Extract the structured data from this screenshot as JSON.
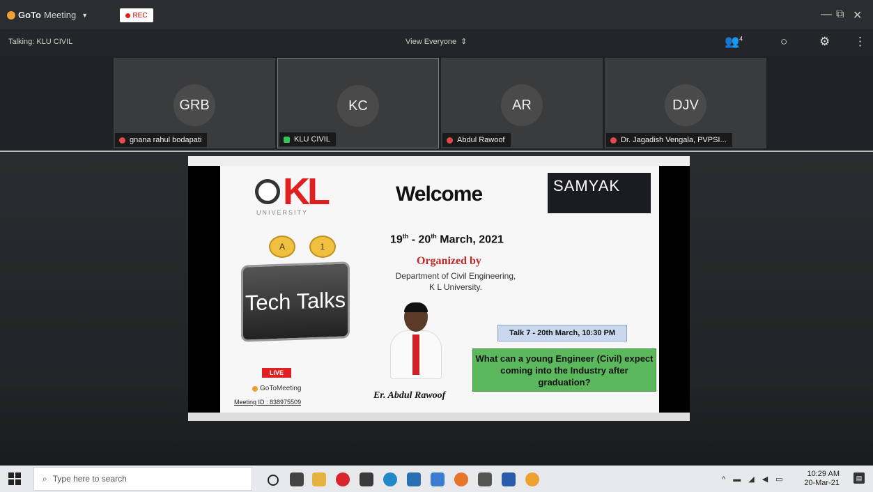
{
  "app": {
    "brand_go": "GoTo",
    "brand_meeting": "Meeting",
    "rec_label": "REC"
  },
  "window": {
    "minimize": "—",
    "maximize": "⧉",
    "close": "✕"
  },
  "infobar": {
    "talking": "Talking: KLU CIVIL",
    "view": "View Everyone",
    "participant_count": "4"
  },
  "participants": [
    {
      "initials": "GRB",
      "name": "gnana rahul bodapati",
      "muted": true
    },
    {
      "initials": "KC",
      "name": "KLU CIVIL",
      "muted": false
    },
    {
      "initials": "AR",
      "name": "Abdul Rawoof",
      "muted": true
    },
    {
      "initials": "DJV",
      "name": "Dr. Jagadish Vengala, PVPSI...",
      "muted": true
    }
  ],
  "slide": {
    "kl": "KL",
    "university": "UNIVERSITY",
    "welcome": "Welcome",
    "samyak": "SAMYAK",
    "dates_a": "19",
    "dates_sup_a": "th",
    "dates_b": " - 20",
    "dates_sup_b": "th",
    "dates_c": " March, 2021",
    "organized_by": "Organized by",
    "dept_line1": "Department of Civil Engineering,",
    "dept_line2": "K L University.",
    "tech_talks": "Tech Talks",
    "talk": "Talk 7 - 20th March, 10:30 PM",
    "question": "What can a young Engineer (Civil) expect coming into the Industry after graduation?",
    "live": "LIVE",
    "gomeeting": "GoToMeeting",
    "meeting_id": "Meeting ID : 838975509",
    "speaker_name": "Er. Abdul Rawoof",
    "badge_a": "A",
    "badge_b": "1"
  },
  "taskbar": {
    "search_placeholder": "Type here to search",
    "time": "10:29 AM",
    "date": "20-Mar-21"
  },
  "colors": {
    "accent_red": "#e02020",
    "gotomeeting_orange": "#f0a030",
    "question_green": "#5cb85c"
  }
}
